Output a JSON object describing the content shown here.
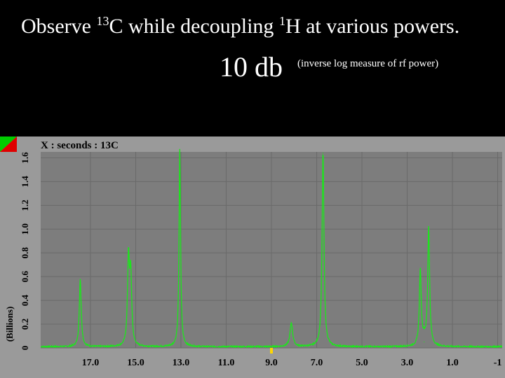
{
  "title": {
    "prefix": "Observe ",
    "isotope_mass_c": "13",
    "carbon": "C while decoupling ",
    "isotope_mass_h": "1",
    "hydrogen": "H at various powers."
  },
  "power": {
    "value": "10 db",
    "note": "(inverse log measure of rf power)"
  },
  "colors": {
    "background": "#000000",
    "panel": "#9a9a9a",
    "plot_area": "#7d7d7d",
    "trace": "#1ce61c",
    "grid": "#6a6a6a",
    "corner_green": "#00cc00",
    "corner_red": "#e00000",
    "marker": "#ffd700"
  },
  "chart_data": {
    "type": "line",
    "title": "X : seconds : 13C",
    "xlabel": "",
    "ylabel": "(Billions)",
    "x_reversed": true,
    "xlim": [
      19.2,
      -1.2
    ],
    "ylim": [
      0,
      1.65
    ],
    "x_ticks": [
      "17.0",
      "15.0",
      "13.0",
      "11.0",
      "9.0",
      "7.0",
      "5.0",
      "3.0",
      "1.0",
      "-1"
    ],
    "x_tick_values": [
      17,
      15,
      13,
      11,
      9,
      7,
      5,
      3,
      1,
      -1
    ],
    "y_ticks": [
      "0",
      "0.2",
      "0.4",
      "0.6",
      "0.8",
      "1.0",
      "1.2",
      "1.4",
      "1.6"
    ],
    "y_tick_values": [
      0,
      0.2,
      0.4,
      0.6,
      0.8,
      1.0,
      1.2,
      1.4,
      1.6
    ],
    "grid": true,
    "baseline": 0.01,
    "series": [
      {
        "peaks": [
          {
            "x": 17.45,
            "y": 0.57,
            "w": 0.05
          },
          {
            "x": 15.32,
            "y": 0.73,
            "w": 0.05
          },
          {
            "x": 15.22,
            "y": 0.58,
            "w": 0.05
          },
          {
            "x": 13.05,
            "y": 1.66,
            "w": 0.04
          },
          {
            "x": 8.12,
            "y": 0.2,
            "w": 0.07
          },
          {
            "x": 6.72,
            "y": 1.64,
            "w": 0.05
          },
          {
            "x": 2.42,
            "y": 0.64,
            "w": 0.05
          },
          {
            "x": 2.05,
            "y": 1.0,
            "w": 0.05
          },
          {
            "x": 2.25,
            "y": 0.05,
            "w": 0.08
          }
        ]
      }
    ]
  }
}
